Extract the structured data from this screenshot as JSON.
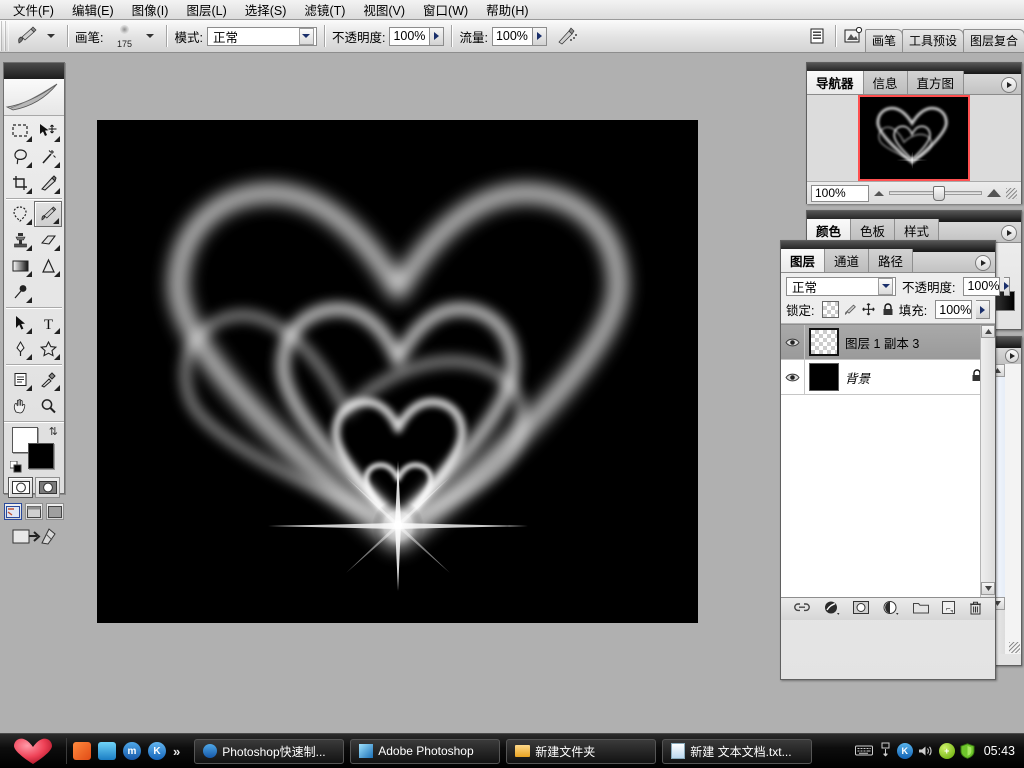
{
  "menu": {
    "items": [
      {
        "label": "文件(F)"
      },
      {
        "label": "编辑(E)"
      },
      {
        "label": "图像(I)"
      },
      {
        "label": "图层(L)"
      },
      {
        "label": "选择(S)"
      },
      {
        "label": "滤镜(T)"
      },
      {
        "label": "视图(V)"
      },
      {
        "label": "窗口(W)"
      },
      {
        "label": "帮助(H)"
      }
    ]
  },
  "options": {
    "tool_icon": "brush-tool-icon",
    "brush_label": "画笔:",
    "brush_size": "175",
    "mode_label": "模式:",
    "mode_value": "正常",
    "opacity_label": "不透明度:",
    "opacity_value": "100%",
    "flow_label": "流量:",
    "flow_value": "100%",
    "airbrush_icon": "airbrush-icon",
    "palette_toggle_icon": "palette-well-icon",
    "imageready_icon": "jump-to-imageready-icon",
    "well_tabs": [
      {
        "label": "画笔"
      },
      {
        "label": "工具预设"
      },
      {
        "label": "图层复合"
      }
    ]
  },
  "toolbox": {
    "tools": [
      {
        "name": "marquee-tool",
        "hidden_menu": true
      },
      {
        "name": "move-tool",
        "hidden_menu": true
      },
      {
        "name": "lasso-tool",
        "hidden_menu": true
      },
      {
        "name": "magic-wand-tool",
        "hidden_menu": true
      },
      {
        "name": "crop-tool",
        "hidden_menu": true
      },
      {
        "name": "slice-tool",
        "hidden_menu": true
      },
      {
        "name": "healing-brush-tool",
        "hidden_menu": true
      },
      {
        "name": "brush-tool",
        "hidden_menu": true,
        "selected": true
      },
      {
        "name": "clone-stamp-tool",
        "hidden_menu": true
      },
      {
        "name": "history-brush-tool",
        "hidden_menu": true
      },
      {
        "name": "eraser-tool",
        "hidden_menu": true
      },
      {
        "name": "gradient-tool",
        "hidden_menu": true
      },
      {
        "name": "blur-tool",
        "hidden_menu": true
      },
      {
        "name": "dodge-tool",
        "hidden_menu": true
      },
      {
        "name": "path-selection-tool",
        "hidden_menu": true
      },
      {
        "name": "type-tool",
        "hidden_menu": true
      },
      {
        "name": "pen-tool",
        "hidden_menu": true
      },
      {
        "name": "shape-tool",
        "hidden_menu": true
      },
      {
        "name": "notes-tool",
        "hidden_menu": true
      },
      {
        "name": "eyedropper-tool",
        "hidden_menu": true
      },
      {
        "name": "hand-tool",
        "hidden_menu": false
      },
      {
        "name": "zoom-tool",
        "hidden_menu": false
      }
    ],
    "foreground_color": "#ffffff",
    "background_color": "#000000",
    "quickmask": [
      "standard-mode",
      "quick-mask-mode"
    ],
    "screen_modes": [
      "standard-screen-mode",
      "full-screen-with-menubar",
      "full-screen-mode"
    ],
    "jump_label": "jump-to-imageready"
  },
  "navigator": {
    "tabs": [
      {
        "label": "导航器",
        "active": true
      },
      {
        "label": "信息",
        "active": false
      },
      {
        "label": "直方图",
        "active": false
      }
    ],
    "zoom_value": "100%",
    "view_box_color": "#ff5050"
  },
  "color_palette": {
    "tabs": [
      {
        "label": "颜色",
        "active": true
      },
      {
        "label": "色板",
        "active": false
      },
      {
        "label": "样式",
        "active": false
      }
    ]
  },
  "layers": {
    "tabs": [
      {
        "label": "图层",
        "active": true
      },
      {
        "label": "通道",
        "active": false
      },
      {
        "label": "路径",
        "active": false
      }
    ],
    "blend_mode": "正常",
    "opacity_label": "不透明度:",
    "opacity_value": "100%",
    "lock_label": "锁定:",
    "lock_icons": [
      "lock-transparency-icon",
      "lock-image-icon",
      "lock-position-icon",
      "lock-all-icon"
    ],
    "fill_label": "填充:",
    "fill_value": "100%",
    "rows": [
      {
        "name": "图层 1 副本 3",
        "visible": true,
        "selected": true,
        "thumb": "transparent",
        "locked": false
      },
      {
        "name": "背景",
        "visible": true,
        "selected": false,
        "thumb": "#000000",
        "locked": true
      }
    ],
    "footer_icons": [
      "link-layers-icon",
      "layer-style-icon",
      "layer-mask-icon",
      "adjustment-layer-icon",
      "new-group-icon",
      "new-layer-icon",
      "delete-layer-icon"
    ]
  },
  "canvas": {
    "title": "heart-artwork",
    "background": "#000000",
    "description": "glowing nested hearts with star flare"
  },
  "taskbar": {
    "start_icon": "heart-start-icon",
    "quicklaunch": [
      {
        "name": "show-desktop-icon",
        "label": ""
      },
      {
        "name": "ie-icon",
        "label": ""
      },
      {
        "name": "maxthon-icon",
        "label": "m"
      },
      {
        "name": "kingsoft-icon",
        "label": "K"
      },
      {
        "name": "more-icon",
        "label": "»"
      }
    ],
    "tasks": [
      {
        "label": "Photoshop快速制...",
        "icon": "maxthon-icon"
      },
      {
        "label": "Adobe Photoshop",
        "icon": "photoshop-icon"
      },
      {
        "label": "新建文件夹",
        "icon": "folder-icon"
      },
      {
        "label": "新建 文本文档.txt...",
        "icon": "notepad-icon"
      }
    ],
    "tray": [
      {
        "name": "input-method-icon",
        "label": ""
      },
      {
        "name": "language-bar-icon",
        "label": ""
      },
      {
        "name": "kingsoft-tray-icon",
        "label": "K"
      },
      {
        "name": "volume-icon",
        "label": ""
      },
      {
        "name": "update-icon",
        "label": "+"
      },
      {
        "name": "security-shield-icon",
        "label": ""
      }
    ],
    "clock": "05:43"
  }
}
